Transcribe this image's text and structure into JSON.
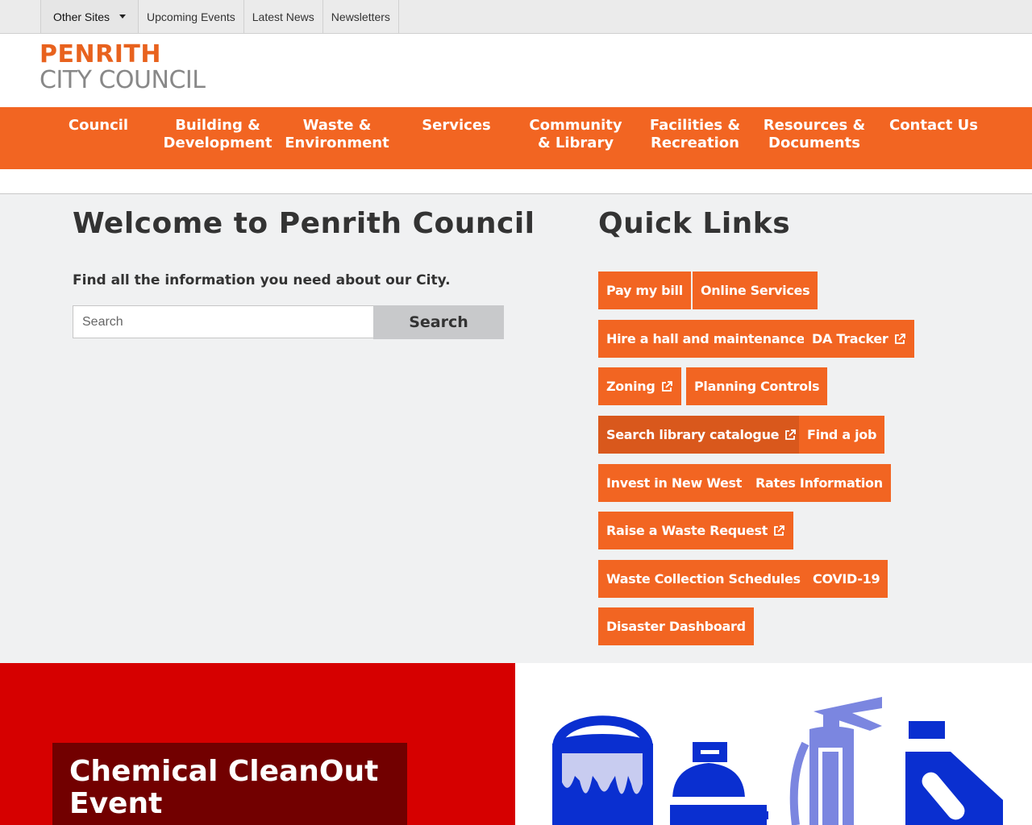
{
  "utility_nav": {
    "other_sites": "Other Sites",
    "upcoming_events": "Upcoming Events",
    "latest_news": "Latest News",
    "newsletters": "Newsletters"
  },
  "logo": {
    "line1": "PENRITH",
    "line2": "CITY COUNCIL"
  },
  "main_nav": [
    {
      "line1": "Council",
      "line2": ""
    },
    {
      "line1": "Building &",
      "line2": "Development"
    },
    {
      "line1": "Waste &",
      "line2": "Environment"
    },
    {
      "line1": "Services",
      "line2": ""
    },
    {
      "line1": "Community",
      "line2": "& Library"
    },
    {
      "line1": "Facilities &",
      "line2": "Recreation"
    },
    {
      "line1": "Resources &",
      "line2": "Documents"
    },
    {
      "line1": "Contact Us",
      "line2": ""
    }
  ],
  "welcome": {
    "title": "Welcome to Penrith Council",
    "subtitle": "Find all the information you need about our City.",
    "search_placeholder": "Search",
    "search_button": "Search"
  },
  "quick_links": {
    "title": "Quick Links",
    "items": [
      {
        "label": "Pay my bill",
        "external": false
      },
      {
        "label": "Online Services",
        "external": false
      },
      {
        "label": "Hire a hall and maintenance",
        "external": false
      },
      {
        "label": "DA Tracker",
        "external": true
      },
      {
        "label": "Zoning",
        "external": true
      },
      {
        "label": "Planning Controls",
        "external": false
      },
      {
        "label": "Search library catalogue",
        "external": true
      },
      {
        "label": "Find a job",
        "external": false
      },
      {
        "label": "Invest in New West",
        "external": false
      },
      {
        "label": "Rates Information",
        "external": false
      },
      {
        "label": "Raise a Waste Request",
        "external": true
      },
      {
        "label": "Waste Collection Schedules",
        "external": false
      },
      {
        "label": "COVID-19",
        "external": false
      },
      {
        "label": "Disaster Dashboard",
        "external": false
      }
    ]
  },
  "banner": {
    "event_title": "Chemical CleanOut Event"
  },
  "colors": {
    "brand_orange": "#f26522",
    "banner_red": "#d60000",
    "event_box": "#720000",
    "icon_blue": "#0a2fd0",
    "icon_light_blue": "#7b86e0"
  },
  "icons": [
    "paint-can-icon",
    "gas-bottle-icon",
    "fire-extinguisher-icon",
    "chemical-bottle-icon",
    "external-link-icon"
  ]
}
